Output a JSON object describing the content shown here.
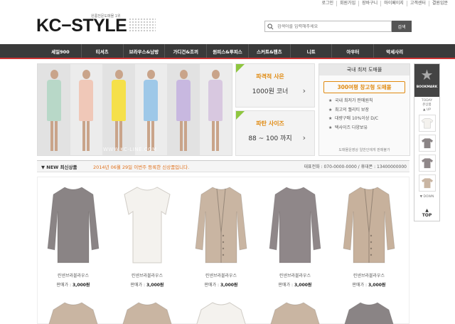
{
  "utility_links": [
    "로그인",
    "회원가입",
    "장바구니",
    "마이페이지",
    "고객센터",
    "결원입문"
  ],
  "logo": {
    "text": "KC−STYLE",
    "sub": "원룸전문도매몰 1위"
  },
  "search": {
    "placeholder": "검색어를 입력해주세요",
    "button": "검색"
  },
  "nav": [
    "세일900",
    "티셔츠",
    "브라우스&남방",
    "가디건&조끼",
    "원피스&투피스",
    "스커트&팬츠",
    "니트",
    "아우터",
    "악세사리"
  ],
  "banner": {
    "watermark": "WWW.KC-LINE.COM",
    "colors": {
      "model_dress": [
        "#b8d8c8",
        "#f0c8b8",
        "#f5e04a",
        "#9ec8e8",
        "#c8b8e0",
        "#d8c8e0"
      ]
    }
  },
  "promo1": {
    "line1": "파격적 사은",
    "line2": "1000원 코너"
  },
  "promo2": {
    "line1": "파탄 사이즈",
    "line2": "88 ~ 100 까지"
  },
  "lowest": {
    "title": "국내 최저 도매몰",
    "promo": "300여평 창고형 도매몰",
    "items": [
      "국내 최저가 판매원칙",
      "최고의 퀄리티 보장",
      "대량구매 10%이상 D/C",
      "택사이즈 다양보유"
    ],
    "footer": "도매몰운영상 일반인에게 판매불가"
  },
  "sidebar": {
    "bookmark": "BOOKMARK",
    "today_line1": "TODAY",
    "today_line2": "본상품",
    "up": "▲ UP",
    "down": "▼ DOWN",
    "top": "TOP"
  },
  "new_bar": {
    "title": "NEW 최신상품",
    "notice": "2014년 06월 29일 이번주 등록한 신상품입니다.",
    "contact": "대표전화 : 070-0000-0000 / 휴대폰 : 13400000000"
  },
  "products": [
    {
      "name": "린넨브라블라우스",
      "price_label": "판매가 :",
      "price": "3,000원",
      "color": "#8a8485",
      "style": "sweater"
    },
    {
      "name": "린넨브라블라우스",
      "price_label": "판매가 :",
      "price": "3,000원",
      "color": "#f4f2ee",
      "style": "tee"
    },
    {
      "name": "린넨브라블라우스",
      "price_label": "판매가 :",
      "price": "3,000원",
      "color": "#c9b5a2",
      "style": "cardigan"
    },
    {
      "name": "린넨브라블라우스",
      "price_label": "판매가 :",
      "price": "3,000원",
      "color": "#8f8789",
      "style": "sweater"
    },
    {
      "name": "린넨브라블라우스",
      "price_label": "판매가 :",
      "price": "3,000원",
      "color": "#c7b19c",
      "style": "cardigan"
    }
  ],
  "products_row2_colors": [
    "#c9b5a2",
    "#c9b5a2",
    "#f4f2ee",
    "#c9b5a2",
    "#8a8485"
  ]
}
